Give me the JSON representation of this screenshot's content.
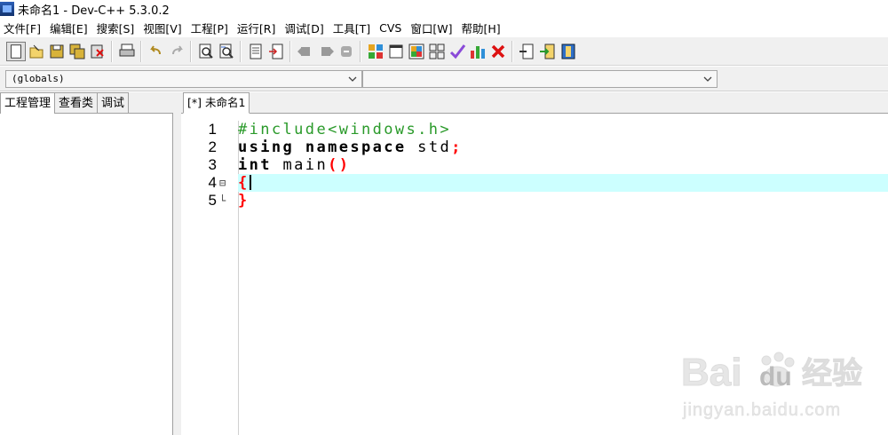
{
  "window": {
    "title": "未命名1 - Dev-C++ 5.3.0.2"
  },
  "menu": [
    "文件[F]",
    "编辑[E]",
    "搜索[S]",
    "视图[V]",
    "工程[P]",
    "运行[R]",
    "调试[D]",
    "工具[T]",
    "CVS",
    "窗口[W]",
    "帮助[H]"
  ],
  "toolbar": {
    "groups": [
      [
        "new-file-icon",
        "open-file-icon",
        "save-icon",
        "save-all-icon",
        "close-file-icon"
      ],
      [
        "print-icon"
      ],
      [
        "undo-icon",
        "redo-icon"
      ],
      [
        "find-icon",
        "replace-icon"
      ],
      [
        "toggle-bookmark-icon",
        "goto-line-icon"
      ],
      [
        "back-icon",
        "forward-icon",
        "stop-icon"
      ],
      [
        "compile-icon",
        "run-icon",
        "compile-run-icon",
        "rebuild-icon",
        "syntax-check-icon",
        "chart-icon",
        "delete-icon"
      ],
      [
        "insert-icon",
        "export-icon",
        "project-options-icon"
      ]
    ]
  },
  "combos": {
    "scope": "(globals)",
    "members": ""
  },
  "left_panel": {
    "tabs": [
      "工程管理",
      "查看类",
      "调试"
    ],
    "active_tab": 0
  },
  "editor": {
    "tab_label": "[*] 未命名1",
    "lines": [
      {
        "num": "1",
        "fold": "",
        "tokens": [
          {
            "t": "#include<windows.h>",
            "c": "pp"
          }
        ]
      },
      {
        "num": "2",
        "fold": "",
        "tokens": [
          {
            "t": "using",
            "c": "kw"
          },
          {
            "t": " ",
            "c": "txt"
          },
          {
            "t": "namespace",
            "c": "kw"
          },
          {
            "t": " std",
            "c": "txt"
          },
          {
            "t": ";",
            "c": "sym"
          }
        ]
      },
      {
        "num": "3",
        "fold": "",
        "tokens": [
          {
            "t": "int",
            "c": "kw"
          },
          {
            "t": " main",
            "c": "txt"
          },
          {
            "t": "()",
            "c": "sym"
          }
        ]
      },
      {
        "num": "4",
        "fold": "⊟",
        "current": true,
        "tokens": [
          {
            "t": "{",
            "c": "sym"
          }
        ]
      },
      {
        "num": "5",
        "fold": "└",
        "tokens": [
          {
            "t": "}",
            "c": "sym"
          }
        ]
      }
    ]
  },
  "watermark": {
    "brand": "Bai",
    "brand2": "du",
    "suffix": "经验",
    "url": "jingyan.baidu.com"
  },
  "colors": {
    "current_line": "#ccffff",
    "preprocessor": "#2a9a2a",
    "symbol": "#ff0000"
  }
}
